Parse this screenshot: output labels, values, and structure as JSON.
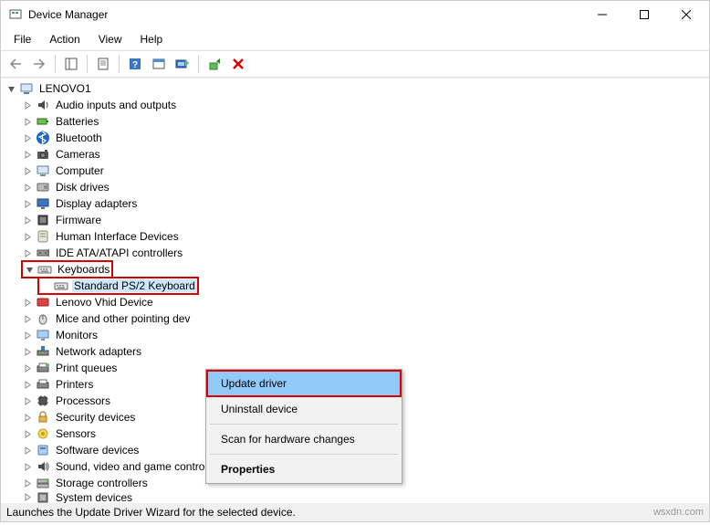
{
  "window": {
    "title": "Device Manager"
  },
  "menu": {
    "file": "File",
    "action": "Action",
    "view": "View",
    "help": "Help"
  },
  "root": "LENOVO1",
  "categories": [
    {
      "label": "Audio inputs and outputs",
      "icon": "audio"
    },
    {
      "label": "Batteries",
      "icon": "battery"
    },
    {
      "label": "Bluetooth",
      "icon": "bluetooth"
    },
    {
      "label": "Cameras",
      "icon": "camera"
    },
    {
      "label": "Computer",
      "icon": "computer"
    },
    {
      "label": "Disk drives",
      "icon": "disk"
    },
    {
      "label": "Display adapters",
      "icon": "display"
    },
    {
      "label": "Firmware",
      "icon": "firmware"
    },
    {
      "label": "Human Interface Devices",
      "icon": "hid"
    },
    {
      "label": "IDE ATA/ATAPI controllers",
      "icon": "ide"
    },
    {
      "label": "Keyboards",
      "icon": "keyboard",
      "expanded": true,
      "highlighted": true,
      "children": [
        {
          "label": "Standard PS/2 Keyboard",
          "icon": "keyboard",
          "selected": true,
          "highlighted": true
        }
      ]
    },
    {
      "label": "Lenovo Vhid Device",
      "icon": "lenovo"
    },
    {
      "label": "Mice and other pointing dev",
      "icon": "mouse",
      "truncated": true
    },
    {
      "label": "Monitors",
      "icon": "monitor"
    },
    {
      "label": "Network adapters",
      "icon": "network"
    },
    {
      "label": "Print queues",
      "icon": "printqueue"
    },
    {
      "label": "Printers",
      "icon": "printer"
    },
    {
      "label": "Processors",
      "icon": "cpu"
    },
    {
      "label": "Security devices",
      "icon": "security"
    },
    {
      "label": "Sensors",
      "icon": "sensor"
    },
    {
      "label": "Software devices",
      "icon": "software"
    },
    {
      "label": "Sound, video and game controllers",
      "icon": "sound"
    },
    {
      "label": "Storage controllers",
      "icon": "storage"
    },
    {
      "label": "System devices",
      "icon": "system",
      "cut": true
    }
  ],
  "context_menu": {
    "update": "Update driver",
    "uninstall": "Uninstall device",
    "scan": "Scan for hardware changes",
    "properties": "Properties"
  },
  "status": "Launches the Update Driver Wizard for the selected device.",
  "watermark": "wsxdn.com"
}
